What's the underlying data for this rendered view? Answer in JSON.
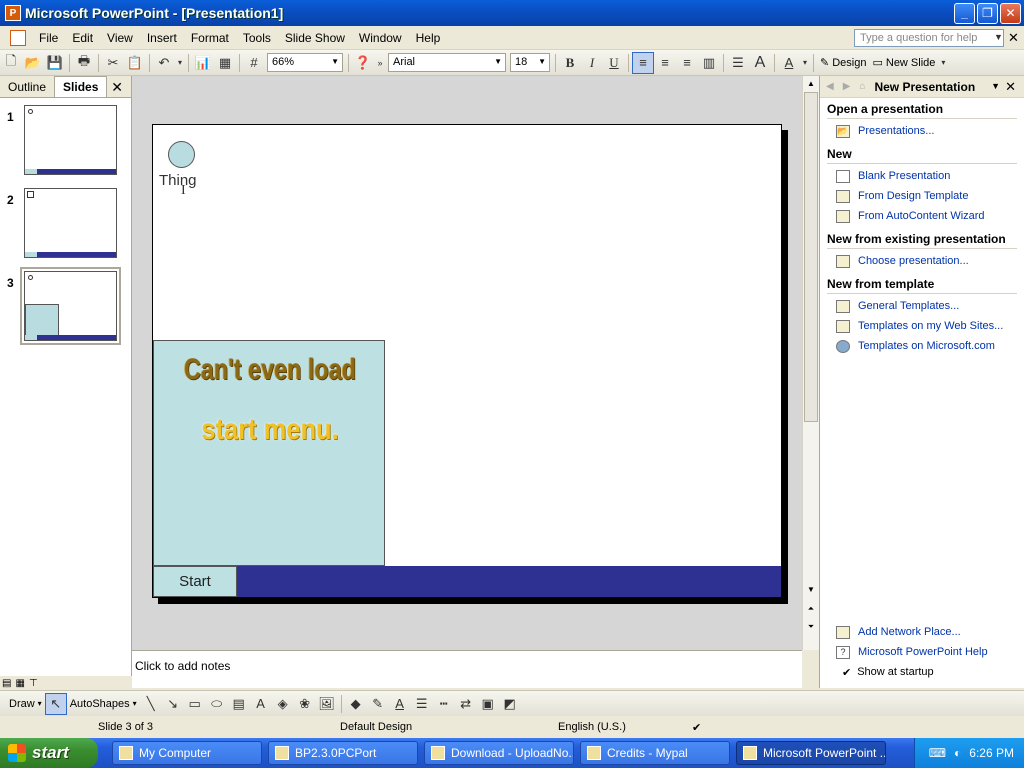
{
  "window": {
    "title": "Microsoft PowerPoint - [Presentation1]"
  },
  "menu": {
    "items": [
      "File",
      "Edit",
      "View",
      "Insert",
      "Format",
      "Tools",
      "Slide Show",
      "Window",
      "Help"
    ],
    "help_placeholder": "Type a question for help"
  },
  "toolbar": {
    "zoom": "66%",
    "font": "Arial",
    "size": "18",
    "bold": "B",
    "italic": "I",
    "underline": "U",
    "design_label": "Design",
    "new_slide_label": "New Slide"
  },
  "left_pane": {
    "tab_outline": "Outline",
    "tab_slides": "Slides",
    "slide_numbers": [
      "1",
      "2",
      "3"
    ]
  },
  "slide": {
    "thing_label": "Thing",
    "wordart_line1": "Can't even load",
    "wordart_line2": "start menu.",
    "start_label": "Start"
  },
  "task_pane": {
    "title": "New Presentation",
    "sections": {
      "open": "Open a presentation",
      "new": "New",
      "existing": "New from existing presentation",
      "template": "New from template"
    },
    "links": {
      "presentations": "Presentations...",
      "blank": "Blank Presentation",
      "design_template": "From Design Template",
      "autocontent": "From AutoContent Wizard",
      "choose": "Choose presentation...",
      "general": "General Templates...",
      "web_sites": "Templates on my Web Sites...",
      "microsoft": "Templates on Microsoft.com",
      "network_place": "Add Network Place...",
      "help": "Microsoft PowerPoint Help",
      "startup": "Show at startup"
    }
  },
  "notes": {
    "placeholder": "Click to add notes"
  },
  "draw_toolbar": {
    "draw_label": "Draw",
    "autoshapes_label": "AutoShapes"
  },
  "status": {
    "slide": "Slide 3 of 3",
    "design": "Default Design",
    "language": "English (U.S.)"
  },
  "taskbar": {
    "start": "start",
    "tasks": [
      "My Computer",
      "BP2.3.0PCPort",
      "Download - UploadNo...",
      "Credits - Mypal",
      "Microsoft PowerPoint ..."
    ],
    "clock": "6:26 PM"
  }
}
